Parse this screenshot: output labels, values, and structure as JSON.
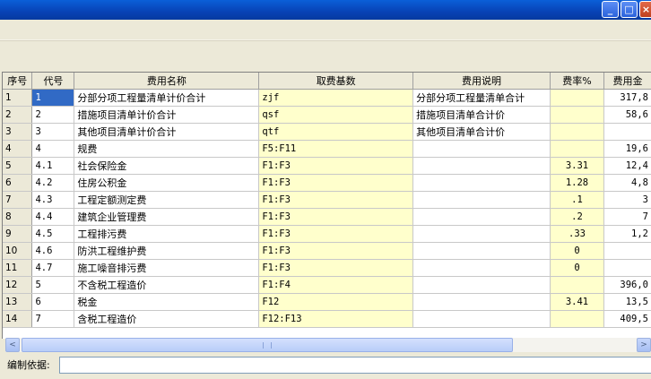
{
  "window": {
    "min_glyph": "_",
    "max_glyph": "□",
    "close_glyph": "×"
  },
  "table": {
    "headers": [
      "序号",
      "代号",
      "费用名称",
      "取费基数",
      "费用说明",
      "费率%",
      "费用金"
    ],
    "rows": [
      {
        "idx": "1",
        "code": "1",
        "name": "分部分项工程量清单计价合计",
        "base": "zjf",
        "desc": "分部分项工程量清单合计",
        "rate": "",
        "amount": "317,8"
      },
      {
        "idx": "2",
        "code": "2",
        "name": "措施项目清单计价合计",
        "base": "qsf",
        "desc": "措施项目清单合计价",
        "rate": "",
        "amount": "58,6"
      },
      {
        "idx": "3",
        "code": "3",
        "name": "其他项目清单计价合计",
        "base": "qtf",
        "desc": "其他项目清单合计价",
        "rate": "",
        "amount": ""
      },
      {
        "idx": "4",
        "code": "4",
        "name": "规费",
        "base": "F5:F11",
        "desc": "",
        "rate": "",
        "amount": "19,6"
      },
      {
        "idx": "5",
        "code": "4.1",
        "name": "社会保险金",
        "base": "F1:F3",
        "desc": "",
        "rate": "3.31",
        "amount": "12,4"
      },
      {
        "idx": "6",
        "code": "4.2",
        "name": "住房公积金",
        "base": "F1:F3",
        "desc": "",
        "rate": "1.28",
        "amount": "4,8"
      },
      {
        "idx": "7",
        "code": "4.3",
        "name": "工程定额测定费",
        "base": "F1:F3",
        "desc": "",
        "rate": ".1",
        "amount": "3"
      },
      {
        "idx": "8",
        "code": "4.4",
        "name": "建筑企业管理费",
        "base": "F1:F3",
        "desc": "",
        "rate": ".2",
        "amount": "7"
      },
      {
        "idx": "9",
        "code": "4.5",
        "name": "工程排污费",
        "base": "F1:F3",
        "desc": "",
        "rate": ".33",
        "amount": "1,2"
      },
      {
        "idx": "10",
        "code": "4.6",
        "name": "防洪工程维护费",
        "base": "F1:F3",
        "desc": "",
        "rate": "0",
        "amount": ""
      },
      {
        "idx": "11",
        "code": "4.7",
        "name": "施工噪音排污费",
        "base": "F1:F3",
        "desc": "",
        "rate": "0",
        "amount": ""
      },
      {
        "idx": "12",
        "code": "5",
        "name": "不含税工程造价",
        "base": "F1:F4",
        "desc": "",
        "rate": "",
        "amount": "396,0"
      },
      {
        "idx": "13",
        "code": "6",
        "name": "税金",
        "base": "F12",
        "desc": "",
        "rate": "3.41",
        "amount": "13,5"
      },
      {
        "idx": "14",
        "code": "7",
        "name": "含税工程造价",
        "base": "F12:F13",
        "desc": "",
        "rate": "",
        "amount": "409,5"
      }
    ]
  },
  "scrollbar": {
    "left_arrow": "<",
    "right_arrow": ">"
  },
  "status": {
    "label": "编制依据:",
    "value": ""
  },
  "colors": {
    "selection": "#316ac5",
    "editable_cell": "#ffffcc",
    "titlebar": "#0a5fd8"
  }
}
